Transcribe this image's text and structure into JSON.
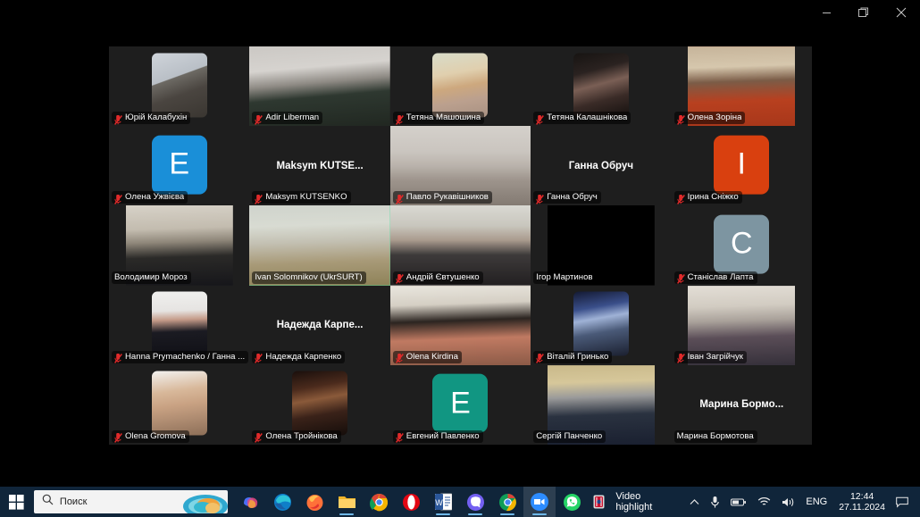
{
  "window": {
    "controls": [
      {
        "name": "minimize",
        "glyph": "minimize"
      },
      {
        "name": "restore",
        "glyph": "restore"
      },
      {
        "name": "close",
        "glyph": "close"
      }
    ]
  },
  "meeting": {
    "layout": {
      "columns": 5,
      "rows": 5
    },
    "speaking_participant": "Ivan Solomnikov (UkrSURT)",
    "participants": [
      {
        "name": "Юрій Калабухін",
        "kind": "photo",
        "muted": true,
        "photo": "portrait-man-suit"
      },
      {
        "name": "Adir Liberman",
        "kind": "video",
        "muted": true,
        "video": "bald-man-dark-shirt"
      },
      {
        "name": "Тетяна Машошина",
        "kind": "photo",
        "muted": true,
        "photo": "portrait-blonde-woman"
      },
      {
        "name": "Тетяна Калашнікова",
        "kind": "photo",
        "muted": true,
        "photo": "portrait-dark-hair-woman"
      },
      {
        "name": "Олена Зоріна",
        "kind": "video",
        "muted": true,
        "video": "woman-glasses-red-top"
      },
      {
        "name": "Олена Ужвієва",
        "kind": "letter",
        "letter": "Е",
        "color": "#1a8fd8",
        "muted": true
      },
      {
        "name": "Maksym KUTSENKO",
        "kind": "name",
        "display_name": "Maksym  KUTSE...",
        "muted": true
      },
      {
        "name": "Павло Рукавішников",
        "kind": "video",
        "muted": true,
        "video": "man-patterned-wall"
      },
      {
        "name": "Ганна Обруч",
        "kind": "name",
        "display_name": "Ганна Обруч",
        "muted": true
      },
      {
        "name": "Ірина Сніжко",
        "kind": "letter",
        "letter": "І",
        "color": "#d9400f",
        "muted": true
      },
      {
        "name": "Володимир Мороз",
        "kind": "video",
        "muted": false,
        "video": "older-man-room"
      },
      {
        "name": "Ivan Solomnikov (UkrSURT)",
        "kind": "video",
        "muted": false,
        "speaking": true,
        "video": "man-flag-office"
      },
      {
        "name": "Андрій Євтушенко",
        "kind": "video",
        "muted": true,
        "video": "bearded-man-window"
      },
      {
        "name": "Ігор Мартинов",
        "kind": "video",
        "muted": false,
        "video": "black-screen"
      },
      {
        "name": "Станіслав Лапта",
        "kind": "letter",
        "letter": "С",
        "color": "#7d95a1",
        "muted": true
      },
      {
        "name": "Hanna Prymachenko / Ганна ...",
        "kind": "photo",
        "muted": true,
        "photo": "portrait-woman-blazer"
      },
      {
        "name": "Надежда Карпенко",
        "kind": "name",
        "display_name": "Надежда  Карпе...",
        "muted": true
      },
      {
        "name": "Olena Kirdina",
        "kind": "video",
        "muted": true,
        "video": "woman-glasses-room"
      },
      {
        "name": "Віталій Гринько",
        "kind": "photo",
        "muted": true,
        "photo": "man-trophy"
      },
      {
        "name": "Іван Загрійчук",
        "kind": "video",
        "muted": true,
        "video": "man-glasses-sofa"
      },
      {
        "name": "Olena Gromova",
        "kind": "photo",
        "muted": true,
        "photo": "portrait-smiling-woman"
      },
      {
        "name": "Олена Тройнікова",
        "kind": "photo",
        "muted": true,
        "photo": "woman-dark-room"
      },
      {
        "name": "Евгений Павленко",
        "kind": "letter",
        "letter": "Е",
        "color": "#119682",
        "muted": true
      },
      {
        "name": "Сергій  Панченко",
        "kind": "video",
        "muted": false,
        "video": "man-office-emblem"
      },
      {
        "name": "Марина Бормотова",
        "kind": "name",
        "display_name": "Марина  Бормо...",
        "muted": false
      }
    ]
  },
  "taskbar": {
    "start_label": "Start",
    "search": {
      "placeholder": "Поиск",
      "icon": "search-icon"
    },
    "apps": [
      {
        "name": "copilot",
        "label": "Copilot",
        "running": false
      },
      {
        "name": "edge",
        "label": "Microsoft Edge",
        "running": false
      },
      {
        "name": "firefox",
        "label": "Firefox",
        "running": false
      },
      {
        "name": "file-explorer",
        "label": "Проводник",
        "running": true
      },
      {
        "name": "chrome",
        "label": "Google Chrome",
        "running": false
      },
      {
        "name": "opera",
        "label": "Opera",
        "running": false
      },
      {
        "name": "word",
        "label": "Word",
        "running": true
      },
      {
        "name": "viber",
        "label": "Viber",
        "running": true
      },
      {
        "name": "chrome-beta",
        "label": "Chrome",
        "running": true
      },
      {
        "name": "zoom",
        "label": "Zoom",
        "running": true,
        "active": true
      },
      {
        "name": "whatsapp",
        "label": "WhatsApp",
        "running": false
      }
    ],
    "tray": {
      "app_name": "Video highlight",
      "overflow_icon": "chevron-up-icon",
      "icons": [
        "microphone-icon",
        "battery-icon",
        "wifi-icon",
        "volume-icon"
      ],
      "language": "ENG",
      "time": "12:44",
      "date": "27.11.2024",
      "notification_icon": "notification-icon"
    }
  }
}
